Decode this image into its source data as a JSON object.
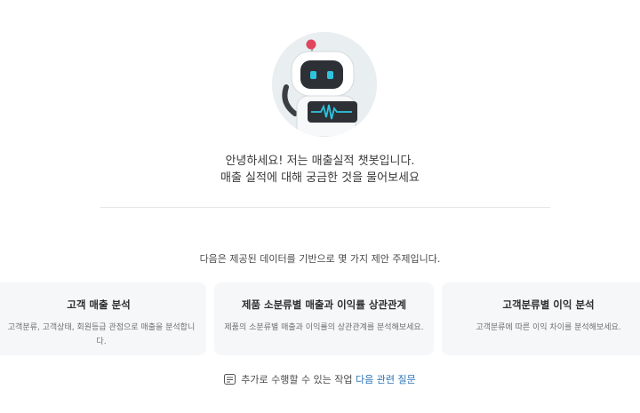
{
  "greeting": {
    "line1": "안녕하세요! 저는 매출실적 챗봇입니다.",
    "line2": "매출 실적에 대해 궁금한 것을 물어보세요"
  },
  "intro": "다음은 제공된 데이터를 기반으로 몇 가지 제안 주제입니다.",
  "cards": [
    {
      "title": "고객 매출 분석",
      "desc": "고객분류, 고객상태, 회원등급 관점으로 매출을 분석합니다."
    },
    {
      "title": "제품 소분류별 매출과 이익률 상관관계",
      "desc": "제품의 소분류별 매출과 이익률의 상관관계를 분석해보세요."
    },
    {
      "title": "고객분류별 이익 분석",
      "desc": "고객분류에 따른 이익 차이를 분석해보세요."
    }
  ],
  "footer": {
    "text": "추가로 수행할 수 있는 작업",
    "link": "다음 관련 질문",
    "icon": "note-icon"
  },
  "colors": {
    "link": "#2b73b8",
    "card_bg": "#f6f7f9",
    "avatar_bg": "#e9eef1",
    "robot_eyes": "#2ec4e0"
  },
  "avatar": {
    "icon": "robot-icon"
  }
}
